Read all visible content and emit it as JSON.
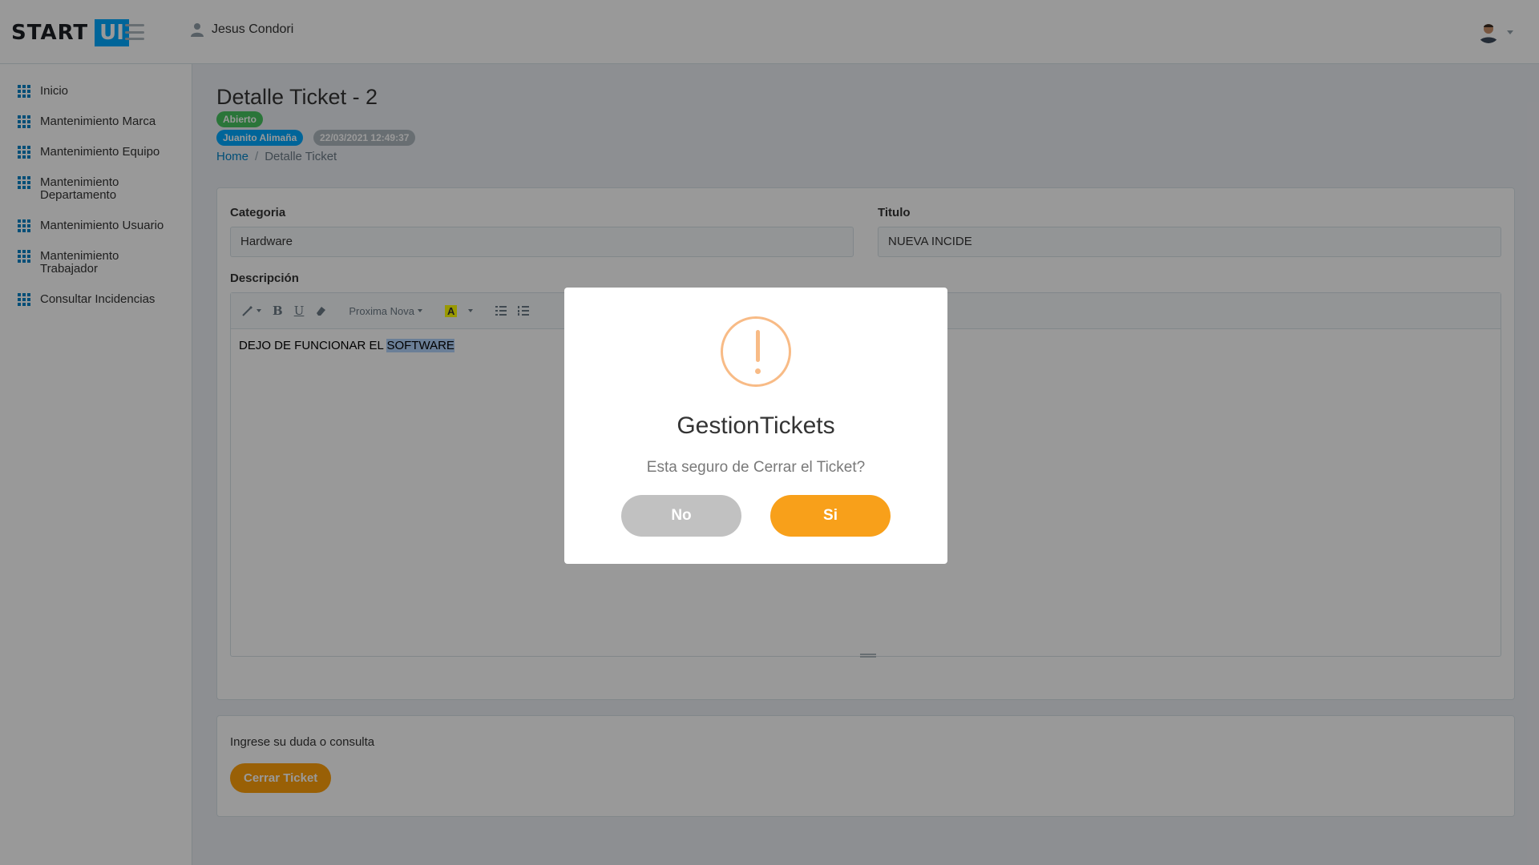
{
  "header": {
    "logo_start": "START",
    "logo_ui": "UI",
    "user_name": "Jesus Condori"
  },
  "sidebar": {
    "items": [
      {
        "label": "Inicio"
      },
      {
        "label": "Mantenimiento Marca"
      },
      {
        "label": "Mantenimiento Equipo"
      },
      {
        "label": "Mantenimiento Departamento"
      },
      {
        "label": "Mantenimiento Usuario"
      },
      {
        "label": "Mantenimiento Trabajador"
      },
      {
        "label": "Consultar Incidencias"
      }
    ]
  },
  "page": {
    "title": "Detalle Ticket - 2",
    "status_badge": "Abierto",
    "user_badge": "Juanito Alimaña",
    "date_badge": "22/03/2021 12:49:37",
    "breadcrumb": {
      "home": "Home",
      "separator": "/",
      "current": "Detalle Ticket"
    }
  },
  "form": {
    "categoria_label": "Categoria",
    "categoria_value": "Hardware",
    "titulo_label": "Titulo",
    "titulo_value": "NUEVA INCIDE",
    "descripcion_label": "Descripción",
    "toolbar": {
      "bold": "B",
      "underline": "U",
      "font": "Proxima Nova",
      "color": "A"
    },
    "descripcion_text_plain": "DEJO DE FUNCIONAR EL ",
    "descripcion_text_selected": "SOFTWARE"
  },
  "bottom": {
    "consulta_text": "Ingrese su duda o consulta",
    "cerrar_button": "Cerrar Ticket"
  },
  "modal": {
    "title": "GestionTickets",
    "text": "Esta seguro de Cerrar el Ticket?",
    "no_button": "No",
    "si_button": "Si"
  },
  "colors": {
    "brand_blue": "#00a8ff",
    "green": "#46c35f",
    "orange": "#f8a01a",
    "warning": "#f8bb86"
  }
}
